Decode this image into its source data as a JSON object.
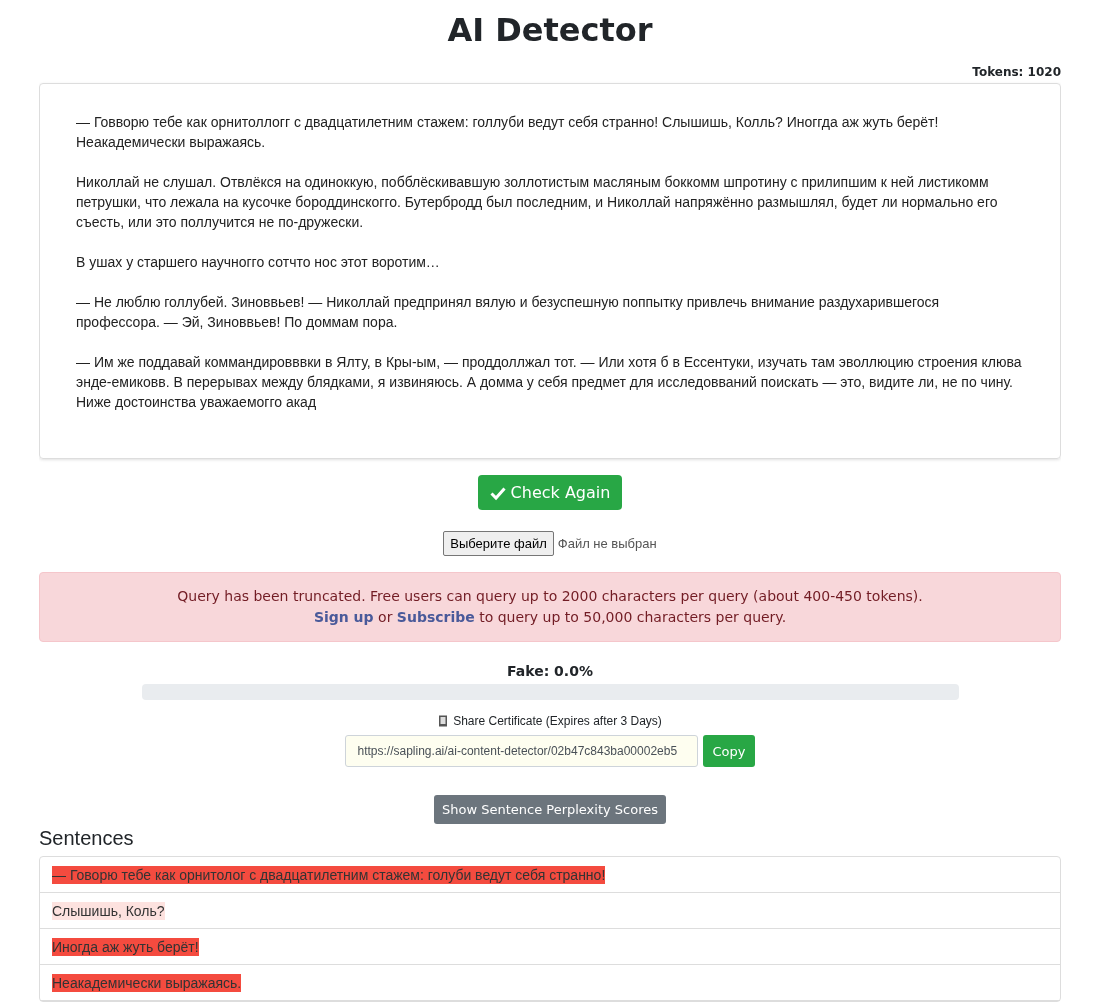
{
  "title": "AI Detector",
  "tokens": "Tokens: 1020",
  "text_paragraphs": [
    "— Говворю тебе как орнитоллогг с двадцатилетним стажем: голлуби ведут себя странно! Слышишь, Колль? Иноггда аж жуть берёт! Неакадемически выражаясь.",
    "Николлай не слушал. Отвлёкся на одиноккую, побблёскивавшую золлотистым масляным боккомм шпротину с прилипшим к ней листикомм петрушки, что лежала на кусочке бороддинскогго. Бутербродд был последним, и Николлай напряжённо размышлял, будет ли нормально его съесть, или это поллучится не по-дружески.",
    "В ушах у старшего научногго сотчто нос этот воротим…",
    "— Не люблю голлубей. Зиноввьев! — Николлай предпринял вялую и безуспешную поппытку привлечь внимание раздухарившегося профессора. — Эй, Зиноввьев! По доммам пора.",
    "— Им же поддавай коммандировввки в Ялту, в Кры-ым, — проддоллжал тот. — Или хотя б в Ессентуки, изучать там эволлюцию строения клюва энде-емиковв. В перерывах между блядками, я извиняюсь. А домма у себя предмет для исследовваний поискать — это, видите ли, не по чину. Ниже достоинства уважаемогго акад"
  ],
  "check_button": "Check Again",
  "file_button": "Выберите файл",
  "file_status": "Файл не выбран",
  "alert": {
    "line_1": "Query has been truncated. Free users can query up to 2000 characters per query (about 400-450 tokens).",
    "line_2": [
      {
        "kind": "link",
        "text": "Sign up"
      },
      {
        "kind": "text",
        "text": " or "
      },
      {
        "kind": "link",
        "text": "Subscribe"
      },
      {
        "kind": "text",
        "text": " to query up to 50,000 characters per query."
      }
    ]
  },
  "fake": {
    "label": "Fake: 0.0%",
    "level": 0
  },
  "share_label": "Share Certificate (Expires after 3 Days)",
  "share_url": "https://sapling.ai/ai-content-detector/02b47c843ba00002eb5",
  "copy_button": "Copy",
  "perplexity_button": "Show Sentence Perplexity Scores",
  "sentences_heading": "Sentences",
  "sentences": [
    {
      "text": "— Говорю тебе как орнитолог с двадцатилетним стажем: голуби ведут себя странно!",
      "color": "#f44b3f"
    },
    {
      "text": "Слышишь, Коль?",
      "color": "#fde2df"
    },
    {
      "text": "Иногда аж жуть берёт!",
      "color": "#f44b3f"
    },
    {
      "text": "Неакадемически выражаясь.",
      "color": "#f44b3f"
    }
  ]
}
